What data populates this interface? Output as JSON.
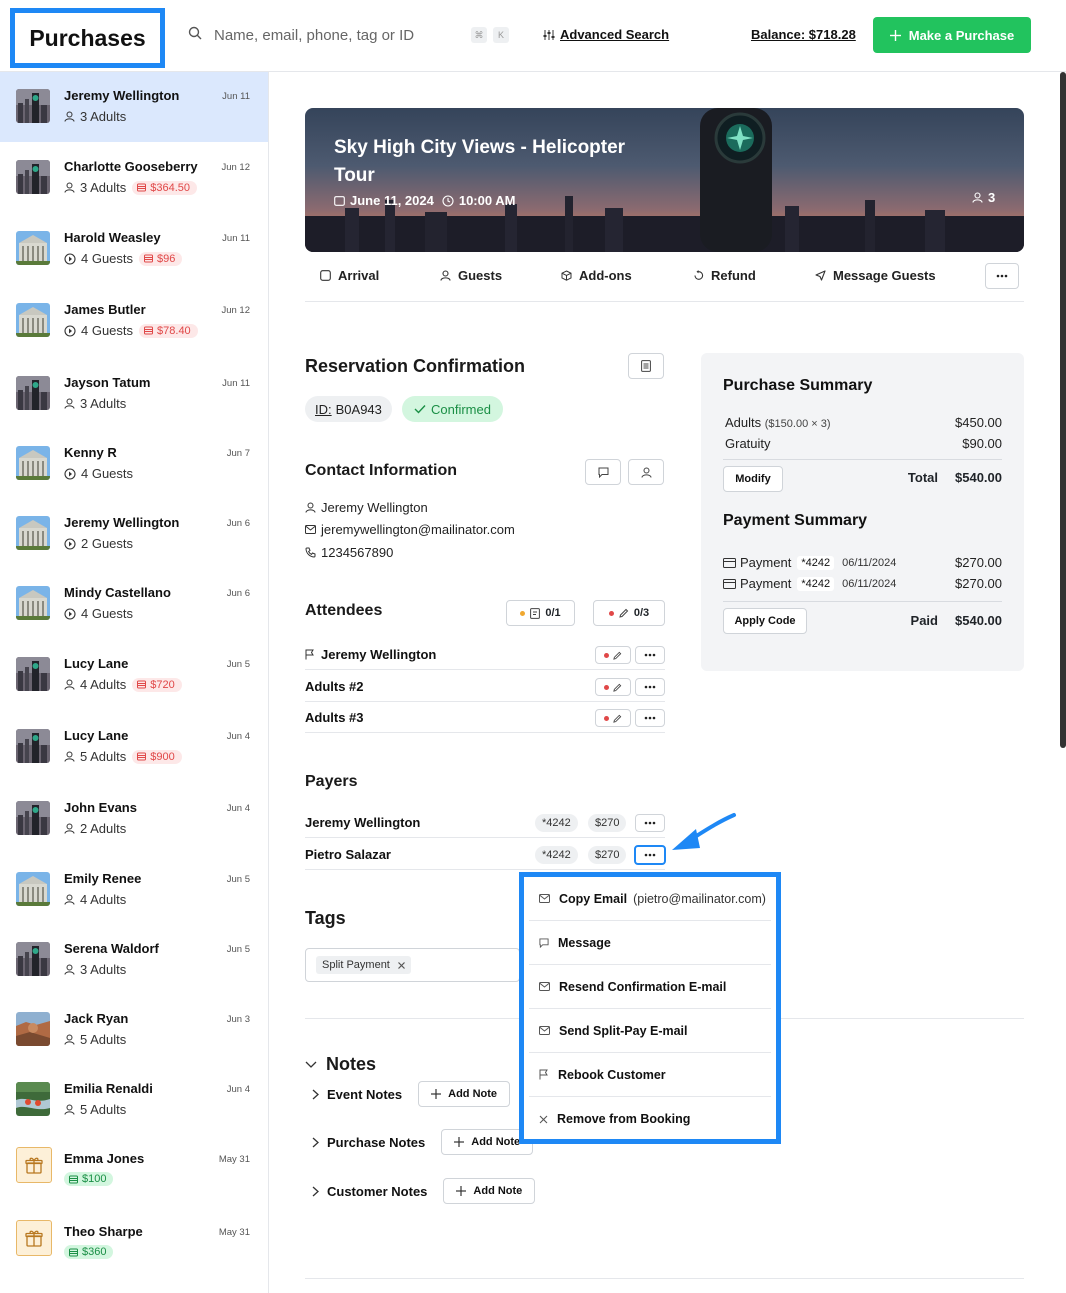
{
  "header": {
    "title": "Purchases",
    "search_placeholder": "Name, email, phone, tag or ID",
    "kbd_cmd": "⌘",
    "kbd_k": "K",
    "advanced_search": "Advanced Search",
    "balance": "Balance: $718.28",
    "make_purchase": "Make a Purchase"
  },
  "sidebar": {
    "items": [
      {
        "name": "Jeremy Wellington",
        "date": "Jun 11",
        "meta": "3 Adults",
        "meta_icon": "person",
        "badge": "",
        "thumb": "city"
      },
      {
        "name": "Charlotte Gooseberry",
        "date": "Jun 12",
        "meta": "3 Adults",
        "meta_icon": "person",
        "badge": "$364.50",
        "thumb": "city"
      },
      {
        "name": "Harold Weasley",
        "date": "Jun 11",
        "meta": "4 Guests",
        "meta_icon": "clock",
        "badge": "$96",
        "thumb": "building"
      },
      {
        "name": "James Butler",
        "date": "Jun 12",
        "meta": "4 Guests",
        "meta_icon": "clock",
        "badge": "$78.40",
        "thumb": "building"
      },
      {
        "name": "Jayson Tatum",
        "date": "Jun 11",
        "meta": "3 Adults",
        "meta_icon": "person",
        "badge": "",
        "thumb": "city"
      },
      {
        "name": "Kenny R",
        "date": "Jun 7",
        "meta": "4 Guests",
        "meta_icon": "clock",
        "badge": "",
        "thumb": "building"
      },
      {
        "name": "Jeremy Wellington",
        "date": "Jun 6",
        "meta": "2 Guests",
        "meta_icon": "clock",
        "badge": "",
        "thumb": "building"
      },
      {
        "name": "Mindy Castellano",
        "date": "Jun 6",
        "meta": "4 Guests",
        "meta_icon": "clock",
        "badge": "",
        "thumb": "building"
      },
      {
        "name": "Lucy Lane",
        "date": "Jun 5",
        "meta": "4 Adults",
        "meta_icon": "person",
        "badge": "$720",
        "thumb": "city"
      },
      {
        "name": "Lucy Lane",
        "date": "Jun 4",
        "meta": "5 Adults",
        "meta_icon": "person",
        "badge": "$900",
        "thumb": "city"
      },
      {
        "name": "John Evans",
        "date": "Jun 4",
        "meta": "2 Adults",
        "meta_icon": "person",
        "badge": "",
        "thumb": "city"
      },
      {
        "name": "Emily Renee",
        "date": "Jun 5",
        "meta": "4 Adults",
        "meta_icon": "person",
        "badge": "",
        "thumb": "building"
      },
      {
        "name": "Serena Waldorf",
        "date": "Jun 5",
        "meta": "3 Adults",
        "meta_icon": "person",
        "badge": "",
        "thumb": "city"
      },
      {
        "name": "Jack Ryan",
        "date": "Jun 3",
        "meta": "5 Adults",
        "meta_icon": "person",
        "badge": "",
        "thumb": "canyon"
      },
      {
        "name": "Emilia Renaldi",
        "date": "Jun 4",
        "meta": "5 Adults",
        "meta_icon": "person",
        "badge": "",
        "thumb": "river"
      },
      {
        "name": "Emma Jones",
        "date": "May 31",
        "meta": "",
        "meta_icon": "",
        "badge": "$100",
        "badge_color": "green",
        "thumb": "gift"
      },
      {
        "name": "Theo Sharpe",
        "date": "May 31",
        "meta": "",
        "meta_icon": "",
        "badge": "$360",
        "badge_color": "green",
        "thumb": "gift"
      }
    ]
  },
  "hero": {
    "title": "Sky High City Views - Helicopter Tour",
    "date": "June 11, 2024",
    "time": "10:00 AM",
    "guest_count": "3"
  },
  "tabs": [
    "Arrival",
    "Guests",
    "Add-ons",
    "Refund",
    "Message Guests"
  ],
  "reservation": {
    "title": "Reservation Confirmation",
    "id_label": "ID:",
    "id_value": "B0A943",
    "status": "Confirmed"
  },
  "contact": {
    "title": "Contact Information",
    "name": "Jeremy Wellington",
    "email": "jeremywellington@mailinator.com",
    "phone": "1234567890"
  },
  "attendees": {
    "title": "Attendees",
    "waiver_count": "0/1",
    "form_count": "0/3",
    "rows": [
      "Jeremy Wellington",
      "Adults #2",
      "Adults #3"
    ]
  },
  "payers": {
    "title": "Payers",
    "rows": [
      {
        "name": "Jeremy Wellington",
        "card": "*4242",
        "amount": "$270"
      },
      {
        "name": "Pietro Salazar",
        "card": "*4242",
        "amount": "$270"
      }
    ]
  },
  "tags": {
    "title": "Tags",
    "items": [
      "Split Payment"
    ]
  },
  "notes": {
    "title": "Notes",
    "sections": [
      "Event Notes",
      "Purchase Notes",
      "Customer Notes"
    ],
    "add_label": "Add Note"
  },
  "purchase_summary": {
    "title": "Purchase Summary",
    "adults_label": "Adults",
    "adults_detail": "($150.00 × 3)",
    "adults_amount": "$450.00",
    "gratuity_label": "Gratuity",
    "gratuity_amount": "$90.00",
    "modify": "Modify",
    "total_label": "Total",
    "total_amount": "$540.00"
  },
  "payment_summary": {
    "title": "Payment Summary",
    "rows": [
      {
        "label": "Payment",
        "card": "*4242",
        "date": "06/11/2024",
        "amount": "$270.00"
      },
      {
        "label": "Payment",
        "card": "*4242",
        "date": "06/11/2024",
        "amount": "$270.00"
      }
    ],
    "apply_code": "Apply Code",
    "paid_label": "Paid",
    "paid_amount": "$540.00"
  },
  "dropdown": {
    "items": [
      {
        "label": "Copy Email",
        "sub": "(pietro@mailinator.com)",
        "icon": "mail"
      },
      {
        "label": "Message",
        "sub": "",
        "icon": "chat"
      },
      {
        "label": "Resend Confirmation E-mail",
        "sub": "",
        "icon": "mail"
      },
      {
        "label": "Send Split-Pay E-mail",
        "sub": "",
        "icon": "mail"
      },
      {
        "label": "Rebook Customer",
        "sub": "",
        "icon": "flag"
      },
      {
        "label": "Remove from Booking",
        "sub": "",
        "icon": "x"
      }
    ]
  },
  "colors": {
    "accent": "#1e88f5",
    "primary_green": "#22c35e",
    "badge_red": "#e04848",
    "badge_green": "#1a8f45"
  }
}
